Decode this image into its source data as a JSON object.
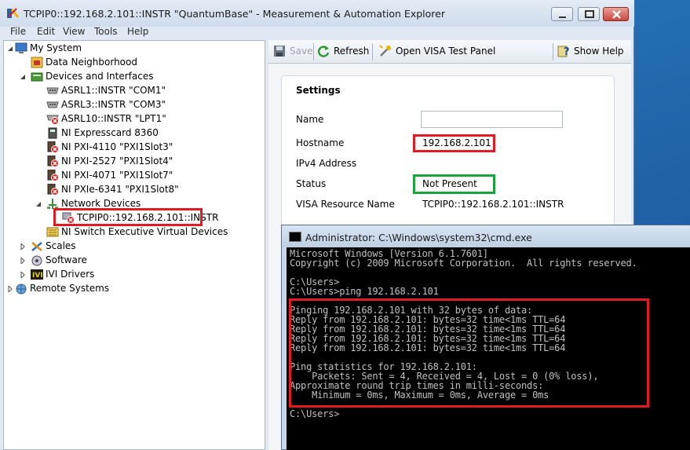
{
  "window": {
    "title": "TCPIP0::192.168.2.101::INSTR \"QuantumBase\" - Measurement & Automation Explorer"
  },
  "menu": [
    "File",
    "Edit",
    "View",
    "Tools",
    "Help"
  ],
  "tree": {
    "nodes": [
      {
        "label": "My System",
        "icon": "computer-icon"
      },
      {
        "label": "Data Neighborhood",
        "icon": "data-neighborhood-icon"
      },
      {
        "label": "Devices and Interfaces",
        "icon": "devices-icon"
      },
      {
        "label": "ASRL1::INSTR \"COM1\"",
        "icon": "serial-port-icon"
      },
      {
        "label": "ASRL3::INSTR \"COM3\"",
        "icon": "serial-port-icon"
      },
      {
        "label": "ASRL10::INSTR \"LPT1\"",
        "icon": "parallel-port-error-icon"
      },
      {
        "label": "NI Expresscard 8360",
        "icon": "device-icon"
      },
      {
        "label": "NI PXI-4110 \"PXI1Slot3\"",
        "icon": "device-error-icon"
      },
      {
        "label": "NI PXI-2527 \"PXI1Slot4\"",
        "icon": "device-error-icon"
      },
      {
        "label": "NI PXI-4071 \"PXI1Slot7\"",
        "icon": "device-error-icon"
      },
      {
        "label": "NI PXIe-6341 \"PXI1Slot8\"",
        "icon": "device-error-icon"
      },
      {
        "label": "Network Devices",
        "icon": "network-icon"
      },
      {
        "label": "TCPIP0::192.168.2.101::INSTR",
        "icon": "network-device-error-icon"
      },
      {
        "label": "NI Switch Executive Virtual Devices",
        "icon": "switch-executive-icon"
      },
      {
        "label": "Scales",
        "icon": "scales-icon"
      },
      {
        "label": "Software",
        "icon": "software-icon"
      },
      {
        "label": "IVI Drivers",
        "icon": "ivi-icon"
      },
      {
        "label": "Remote Systems",
        "icon": "remote-systems-icon"
      }
    ]
  },
  "toolbar": {
    "save": "Save",
    "refresh": "Refresh",
    "visa_test_panel": "Open VISA Test Panel",
    "show_help": "Show Help"
  },
  "settings": {
    "title": "Settings",
    "name_label": "Name",
    "name_value": "",
    "hostname_label": "Hostname",
    "hostname_value": "192.168.2.101",
    "ipv4_label": "IPv4 Address",
    "status_label": "Status",
    "status_value": "Not Present",
    "visa_label": "VISA Resource Name",
    "visa_value": "TCPIP0::192.168.2.101::INSTR"
  },
  "cmd": {
    "title": "Administrator: C:\\Windows\\system32\\cmd.exe",
    "lines": [
      "Microsoft Windows [Version 6.1.7601]",
      "Copyright (c) 2009 Microsoft Corporation.  All rights reserved.",
      "",
      "C:\\Users>",
      "C:\\Users>ping 192.168.2.101",
      "",
      "Pinging 192.168.2.101 with 32 bytes of data:",
      "Reply from 192.168.2.101: bytes=32 time<1ms TTL=64",
      "Reply from 192.168.2.101: bytes=32 time<1ms TTL=64",
      "Reply from 192.168.2.101: bytes=32 time<1ms TTL=64",
      "Reply from 192.168.2.101: bytes=32 time<1ms TTL=64",
      "",
      "Ping statistics for 192.168.2.101:",
      "    Packets: Sent = 4, Received = 4, Lost = 0 (0% loss),",
      "Approximate round trip times in milli-seconds:",
      "    Minimum = 0ms, Maximum = 0ms, Average = 0ms",
      "",
      "C:\\Users>"
    ]
  }
}
